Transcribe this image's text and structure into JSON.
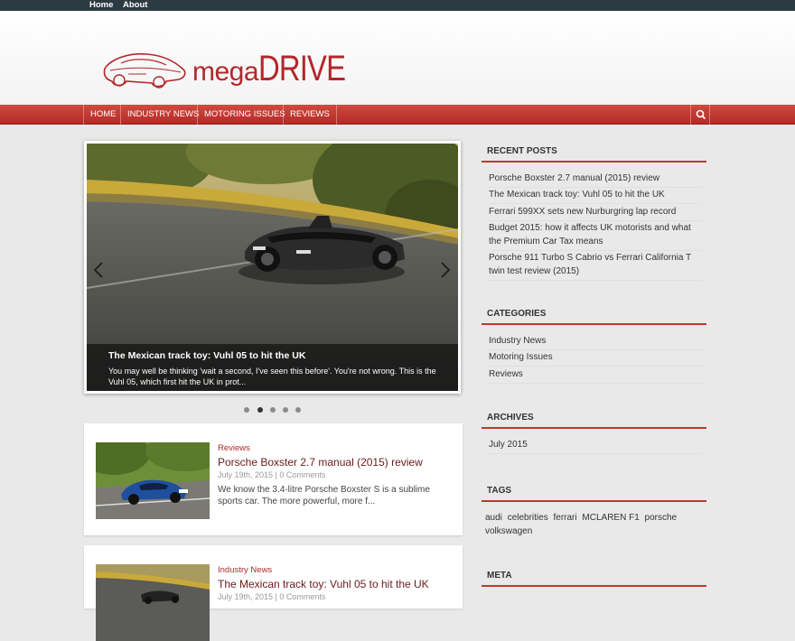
{
  "topbar": {
    "links": [
      "Home",
      "About"
    ]
  },
  "logo": {
    "mega": "mega",
    "drive": "DRIVE",
    "accent": "#b1282b"
  },
  "nav": {
    "items": [
      "HOME",
      "INDUSTRY NEWS",
      "MOTORING ISSUES",
      "REVIEWS"
    ],
    "search_icon": "search-icon"
  },
  "slider": {
    "caption_title": "The Mexican track toy: Vuhl 05 to hit the UK",
    "caption_text": "You may well be thinking 'wait a second, I've seen this before'. You're not wrong. This is the Vuhl 05, which first hit the UK in prot...",
    "dots": 5,
    "active_dot": 2
  },
  "posts": [
    {
      "category": "Reviews",
      "title": "Porsche Boxster 2.7 manual (2015) review",
      "date": "July 19th, 2015",
      "comments": "0 Comments",
      "excerpt": "We know the 3.4-litre Porsche Boxster S is a sublime sports car. The more powerful, more f..."
    },
    {
      "category": "Industry News",
      "title": "The Mexican track toy: Vuhl 05 to hit the UK",
      "date": "July 19th, 2015",
      "comments": "0 Comments",
      "excerpt": ""
    }
  ],
  "sidebar": {
    "recent_posts": {
      "title": "RECENT POSTS",
      "items": [
        "Porsche Boxster 2.7 manual (2015) review",
        "The Mexican track toy: Vuhl 05 to hit the UK",
        "Ferrari 599XX sets new Nurburgring lap record",
        "Budget 2015: how it affects UK motorists and what the Premium Car Tax means",
        "Porsche 911 Turbo S Cabrio vs Ferrari California T twin test review (2015)"
      ]
    },
    "categories": {
      "title": "CATEGORIES",
      "items": [
        "Industry News",
        "Motoring Issues",
        "Reviews"
      ]
    },
    "archives": {
      "title": "ARCHIVES",
      "items": [
        "July 2015"
      ]
    },
    "tags": {
      "title": "TAGS",
      "items": [
        "audi",
        "celebrities",
        "ferrari",
        "MCLAREN F1",
        "porsche",
        "volkswagen"
      ]
    },
    "meta": {
      "title": "META"
    }
  }
}
